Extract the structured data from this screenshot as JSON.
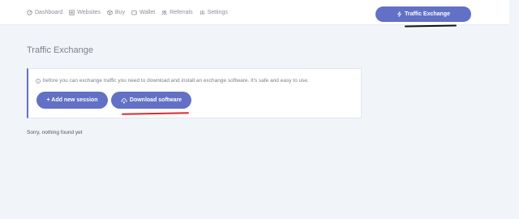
{
  "nav": {
    "items": [
      {
        "label": "Dashboard",
        "icon": "dashboard-icon"
      },
      {
        "label": "Websites",
        "icon": "list-icon"
      },
      {
        "label": "Buy",
        "icon": "cube-icon"
      },
      {
        "label": "Wallet",
        "icon": "wallet-icon"
      },
      {
        "label": "Referrals",
        "icon": "users-icon"
      },
      {
        "label": "Settings",
        "icon": "sliders-icon"
      }
    ],
    "active_button": {
      "label": "Traffic Exchange",
      "icon": "bolt-icon"
    }
  },
  "page": {
    "title": "Traffic Exchange",
    "info": "before you can exchange traffic you need to download and install an exchange software. It's safe and easy to use.",
    "add_session_label": "+ Add new session",
    "download_label": "Download software",
    "empty_message": "Sorry, nothing found yet"
  },
  "colors": {
    "accent": "#6270c5",
    "background": "#f1f4f9",
    "annotation_red": "#e0282e",
    "annotation_black": "#111111"
  }
}
